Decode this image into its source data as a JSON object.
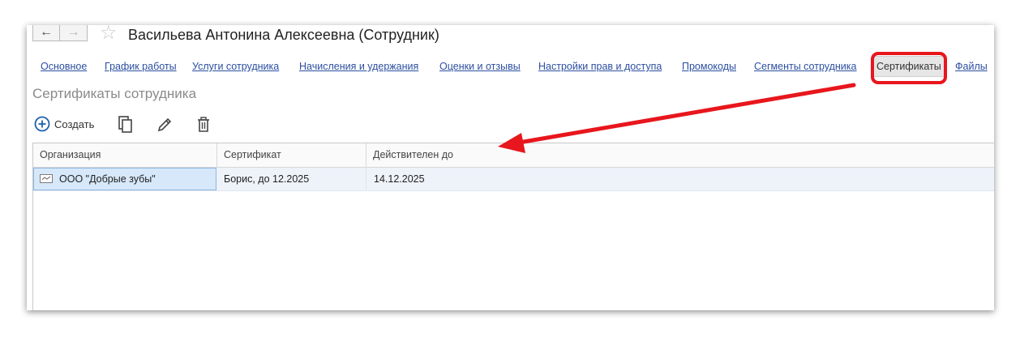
{
  "window": {
    "title": "Васильева Антонина Алексеевна (Сотрудник)",
    "back_icon": "←",
    "forward_icon": "→",
    "star_icon": "☆"
  },
  "tabs": [
    {
      "label": "Основное"
    },
    {
      "label": "График работы"
    },
    {
      "label": "Услуги сотрудника"
    },
    {
      "label": "Начисления и удержания"
    },
    {
      "label": "Оценки и отзывы"
    },
    {
      "label": "Настройки прав и доступа"
    },
    {
      "label": "Промокоды"
    },
    {
      "label": "Сегменты сотрудника"
    },
    {
      "label": "Сертификаты",
      "active": true
    },
    {
      "label": "Файлы"
    }
  ],
  "section": {
    "title": "Сертификаты сотрудника"
  },
  "toolbar": {
    "create_label": "Создать",
    "icons": [
      "plus-circle-icon",
      "copy-icon",
      "pencil-icon",
      "trash-icon"
    ]
  },
  "table": {
    "columns": [
      "Организация",
      "Сертификат",
      "Действителен до"
    ],
    "rows": [
      {
        "organization": "ООО \"Добрые зубы\"",
        "certificate": "Борис, до 12.2025",
        "valid_until": "14.12.2025"
      }
    ]
  },
  "annotation": {
    "highlight_color": "#e8161d"
  },
  "colors": {
    "link": "#2c4fa0",
    "accent": "#1f5fae",
    "selection": "#d6e8fa"
  }
}
